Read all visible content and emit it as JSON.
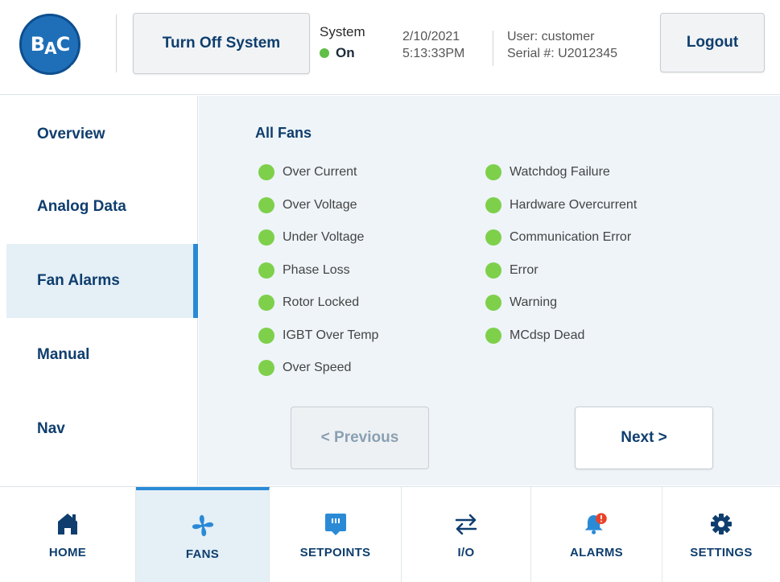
{
  "header": {
    "logo_text": "BAC",
    "turn_off_label": "Turn Off System",
    "system_label": "System",
    "system_status": "On",
    "date": "2/10/2021",
    "time": "5:13:33PM",
    "user": "User: customer",
    "serial": "Serial #: U2012345",
    "logout_label": "Logout"
  },
  "sidebar": {
    "items": [
      {
        "label": "Overview"
      },
      {
        "label": "Analog Data"
      },
      {
        "label": "Fan Alarms"
      },
      {
        "label": "Manual"
      },
      {
        "label": "Nav"
      }
    ]
  },
  "main": {
    "title": "All Fans",
    "left_alarms": [
      "Over Current",
      "Over Voltage",
      "Under Voltage",
      "Phase Loss",
      "Rotor Locked",
      "IGBT Over Temp",
      "Over Speed"
    ],
    "right_alarms": [
      "Watchdog Failure",
      "Hardware Overcurrent",
      "Communication Error",
      "Error",
      "Warning",
      "MCdsp Dead"
    ],
    "previous_label": "< Previous",
    "next_label": "Next >"
  },
  "bottom_nav": {
    "tabs": [
      {
        "label": "HOME",
        "icon": "home-icon"
      },
      {
        "label": "FANS",
        "icon": "fan-icon"
      },
      {
        "label": "SETPOINTS",
        "icon": "setpoints-icon"
      },
      {
        "label": "I/O",
        "icon": "io-arrows-icon"
      },
      {
        "label": "ALARMS",
        "icon": "alarm-bell-icon"
      },
      {
        "label": "SETTINGS",
        "icon": "gear-icon"
      }
    ]
  },
  "colors": {
    "brand": "#1f6fb8",
    "accent": "#2a8ad6",
    "status_ok": "#7ed04b",
    "alert": "#e8432a"
  }
}
